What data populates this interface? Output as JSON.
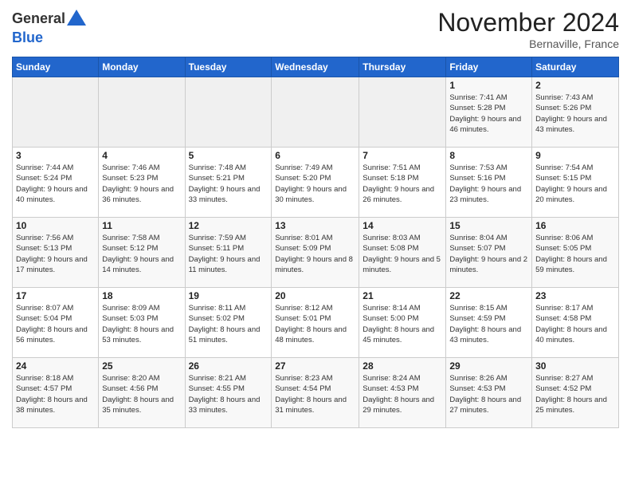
{
  "header": {
    "logo_general": "General",
    "logo_blue": "Blue",
    "month_title": "November 2024",
    "location": "Bernaville, France"
  },
  "weekdays": [
    "Sunday",
    "Monday",
    "Tuesday",
    "Wednesday",
    "Thursday",
    "Friday",
    "Saturday"
  ],
  "weeks": [
    [
      {
        "day": "",
        "empty": true
      },
      {
        "day": "",
        "empty": true
      },
      {
        "day": "",
        "empty": true
      },
      {
        "day": "",
        "empty": true
      },
      {
        "day": "",
        "empty": true
      },
      {
        "day": "1",
        "sunrise": "Sunrise: 7:41 AM",
        "sunset": "Sunset: 5:28 PM",
        "daylight": "Daylight: 9 hours and 46 minutes."
      },
      {
        "day": "2",
        "sunrise": "Sunrise: 7:43 AM",
        "sunset": "Sunset: 5:26 PM",
        "daylight": "Daylight: 9 hours and 43 minutes."
      }
    ],
    [
      {
        "day": "3",
        "sunrise": "Sunrise: 7:44 AM",
        "sunset": "Sunset: 5:24 PM",
        "daylight": "Daylight: 9 hours and 40 minutes."
      },
      {
        "day": "4",
        "sunrise": "Sunrise: 7:46 AM",
        "sunset": "Sunset: 5:23 PM",
        "daylight": "Daylight: 9 hours and 36 minutes."
      },
      {
        "day": "5",
        "sunrise": "Sunrise: 7:48 AM",
        "sunset": "Sunset: 5:21 PM",
        "daylight": "Daylight: 9 hours and 33 minutes."
      },
      {
        "day": "6",
        "sunrise": "Sunrise: 7:49 AM",
        "sunset": "Sunset: 5:20 PM",
        "daylight": "Daylight: 9 hours and 30 minutes."
      },
      {
        "day": "7",
        "sunrise": "Sunrise: 7:51 AM",
        "sunset": "Sunset: 5:18 PM",
        "daylight": "Daylight: 9 hours and 26 minutes."
      },
      {
        "day": "8",
        "sunrise": "Sunrise: 7:53 AM",
        "sunset": "Sunset: 5:16 PM",
        "daylight": "Daylight: 9 hours and 23 minutes."
      },
      {
        "day": "9",
        "sunrise": "Sunrise: 7:54 AM",
        "sunset": "Sunset: 5:15 PM",
        "daylight": "Daylight: 9 hours and 20 minutes."
      }
    ],
    [
      {
        "day": "10",
        "sunrise": "Sunrise: 7:56 AM",
        "sunset": "Sunset: 5:13 PM",
        "daylight": "Daylight: 9 hours and 17 minutes."
      },
      {
        "day": "11",
        "sunrise": "Sunrise: 7:58 AM",
        "sunset": "Sunset: 5:12 PM",
        "daylight": "Daylight: 9 hours and 14 minutes."
      },
      {
        "day": "12",
        "sunrise": "Sunrise: 7:59 AM",
        "sunset": "Sunset: 5:11 PM",
        "daylight": "Daylight: 9 hours and 11 minutes."
      },
      {
        "day": "13",
        "sunrise": "Sunrise: 8:01 AM",
        "sunset": "Sunset: 5:09 PM",
        "daylight": "Daylight: 9 hours and 8 minutes."
      },
      {
        "day": "14",
        "sunrise": "Sunrise: 8:03 AM",
        "sunset": "Sunset: 5:08 PM",
        "daylight": "Daylight: 9 hours and 5 minutes."
      },
      {
        "day": "15",
        "sunrise": "Sunrise: 8:04 AM",
        "sunset": "Sunset: 5:07 PM",
        "daylight": "Daylight: 9 hours and 2 minutes."
      },
      {
        "day": "16",
        "sunrise": "Sunrise: 8:06 AM",
        "sunset": "Sunset: 5:05 PM",
        "daylight": "Daylight: 8 hours and 59 minutes."
      }
    ],
    [
      {
        "day": "17",
        "sunrise": "Sunrise: 8:07 AM",
        "sunset": "Sunset: 5:04 PM",
        "daylight": "Daylight: 8 hours and 56 minutes."
      },
      {
        "day": "18",
        "sunrise": "Sunrise: 8:09 AM",
        "sunset": "Sunset: 5:03 PM",
        "daylight": "Daylight: 8 hours and 53 minutes."
      },
      {
        "day": "19",
        "sunrise": "Sunrise: 8:11 AM",
        "sunset": "Sunset: 5:02 PM",
        "daylight": "Daylight: 8 hours and 51 minutes."
      },
      {
        "day": "20",
        "sunrise": "Sunrise: 8:12 AM",
        "sunset": "Sunset: 5:01 PM",
        "daylight": "Daylight: 8 hours and 48 minutes."
      },
      {
        "day": "21",
        "sunrise": "Sunrise: 8:14 AM",
        "sunset": "Sunset: 5:00 PM",
        "daylight": "Daylight: 8 hours and 45 minutes."
      },
      {
        "day": "22",
        "sunrise": "Sunrise: 8:15 AM",
        "sunset": "Sunset: 4:59 PM",
        "daylight": "Daylight: 8 hours and 43 minutes."
      },
      {
        "day": "23",
        "sunrise": "Sunrise: 8:17 AM",
        "sunset": "Sunset: 4:58 PM",
        "daylight": "Daylight: 8 hours and 40 minutes."
      }
    ],
    [
      {
        "day": "24",
        "sunrise": "Sunrise: 8:18 AM",
        "sunset": "Sunset: 4:57 PM",
        "daylight": "Daylight: 8 hours and 38 minutes."
      },
      {
        "day": "25",
        "sunrise": "Sunrise: 8:20 AM",
        "sunset": "Sunset: 4:56 PM",
        "daylight": "Daylight: 8 hours and 35 minutes."
      },
      {
        "day": "26",
        "sunrise": "Sunrise: 8:21 AM",
        "sunset": "Sunset: 4:55 PM",
        "daylight": "Daylight: 8 hours and 33 minutes."
      },
      {
        "day": "27",
        "sunrise": "Sunrise: 8:23 AM",
        "sunset": "Sunset: 4:54 PM",
        "daylight": "Daylight: 8 hours and 31 minutes."
      },
      {
        "day": "28",
        "sunrise": "Sunrise: 8:24 AM",
        "sunset": "Sunset: 4:53 PM",
        "daylight": "Daylight: 8 hours and 29 minutes."
      },
      {
        "day": "29",
        "sunrise": "Sunrise: 8:26 AM",
        "sunset": "Sunset: 4:53 PM",
        "daylight": "Daylight: 8 hours and 27 minutes."
      },
      {
        "day": "30",
        "sunrise": "Sunrise: 8:27 AM",
        "sunset": "Sunset: 4:52 PM",
        "daylight": "Daylight: 8 hours and 25 minutes."
      }
    ]
  ]
}
